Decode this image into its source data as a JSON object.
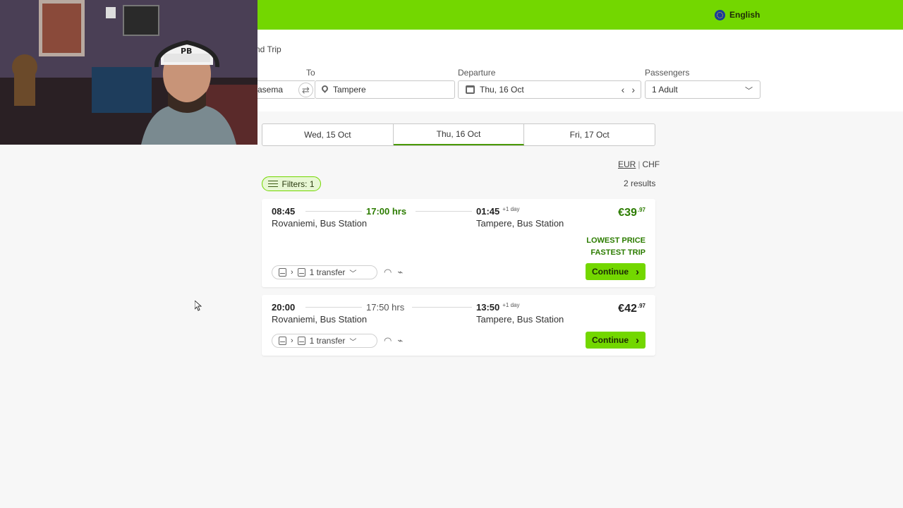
{
  "header": {
    "language": "English"
  },
  "search": {
    "trip_type": "nd Trip",
    "from_label": "",
    "from_value": "asema",
    "to_label": "To",
    "to_value": "Tampere",
    "departure_label": "Departure",
    "departure_value": "Thu, 16 Oct",
    "passengers_label": "Passengers",
    "passengers_value": "1 Adult"
  },
  "date_tabs": [
    {
      "label": "Wed, 15 Oct"
    },
    {
      "label": "Thu, 16 Oct",
      "active": true
    },
    {
      "label": "Fri, 17 Oct"
    }
  ],
  "currency": {
    "primary": "EUR",
    "secondary": "CHF"
  },
  "filters": {
    "label": "Filters: 1"
  },
  "results_count": "2 results",
  "results": [
    {
      "departure_time": "08:45",
      "duration": "17:00 hrs",
      "arrival_time": "01:45",
      "arrival_day_offset": "+1 day",
      "from_station": "Rovaniemi, Bus Station",
      "to_station": "Tampere, Bus Station",
      "price_main": "€39",
      "price_cents": ".97",
      "tags": [
        "LOWEST PRICE",
        "FASTEST TRIP"
      ],
      "transfers": "1 transfer",
      "continue_label": "Continue"
    },
    {
      "departure_time": "20:00",
      "duration": "17:50 hrs",
      "arrival_time": "13:50",
      "arrival_day_offset": "+1 day",
      "from_station": "Rovaniemi, Bus Station",
      "to_station": "Tampere, Bus Station",
      "price_main": "€42",
      "price_cents": ".97",
      "tags": [],
      "transfers": "1 transfer",
      "continue_label": "Continue"
    }
  ],
  "colors": {
    "brand_green": "#73d700",
    "highlight_green": "#2c7c00"
  }
}
